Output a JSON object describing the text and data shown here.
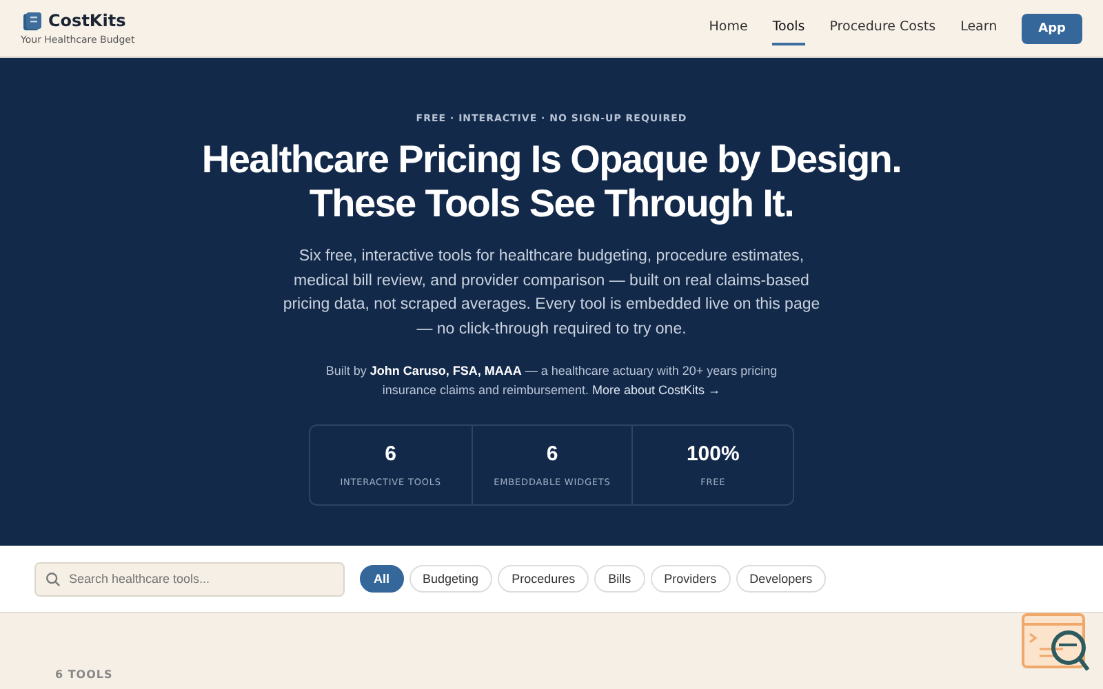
{
  "brand": {
    "name": "CostKits",
    "tagline": "Your Healthcare Budget"
  },
  "nav": [
    {
      "label": "Home",
      "selected": false
    },
    {
      "label": "Tools",
      "selected": true
    },
    {
      "label": "Procedure Costs",
      "selected": false
    },
    {
      "label": "Learn",
      "selected": false
    }
  ],
  "app_button": "App",
  "hero": {
    "eyebrow": "FREE · INTERACTIVE · NO SIGN-UP REQUIRED",
    "title_lines": [
      "Healthcare Pricing Is Opaque by Design.",
      "These Tools See Through It."
    ],
    "intro": "Six free, interactive tools for healthcare budgeting, procedure estimates, medical bill review, and provider comparison — built on real claims-based pricing data, not scraped averages. Every tool is embedded live on this page — no click-through required to try one.",
    "byline": "Built by **John Caruso, FSA, MAAA** — a healthcare actuary with 20+ years pricing insurance claims and reimbursement.",
    "byline_link": "More about CostKits →",
    "stats": [
      {
        "value": "6",
        "label": "INTERACTIVE TOOLS"
      },
      {
        "value": "6",
        "label": "EMBEDDABLE WIDGETS"
      },
      {
        "value": "100%",
        "label": "FREE"
      }
    ]
  },
  "search": {
    "placeholder": "Search healthcare tools..."
  },
  "filters": [
    {
      "label": "All",
      "selected": true
    },
    {
      "label": "Budgeting",
      "selected": false
    },
    {
      "label": "Procedures",
      "selected": false
    },
    {
      "label": "Bills",
      "selected": false
    },
    {
      "label": "Providers",
      "selected": false
    },
    {
      "label": "Developers",
      "selected": false
    }
  ],
  "tool_count": "6 TOOLS"
}
